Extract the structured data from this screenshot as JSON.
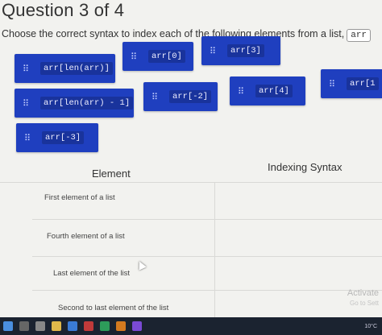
{
  "question": {
    "title": "Question 3 of 4",
    "prompt": "Choose the correct syntax to index each of the following elements from a list,",
    "prompt_code": "arr"
  },
  "chips": [
    {
      "code": "arr[len(arr)]"
    },
    {
      "code": "arr[0]"
    },
    {
      "code": "arr[3]"
    },
    {
      "code": "arr[len(arr) - 1]"
    },
    {
      "code": "arr[-2]"
    },
    {
      "code": "arr[4]"
    },
    {
      "code": "arr[1"
    },
    {
      "code": "arr[-3]"
    }
  ],
  "grip_glyph": "⠿",
  "table": {
    "col_element": "Element",
    "col_syntax": "Indexing Syntax",
    "rows": [
      {
        "label": "First element of a list"
      },
      {
        "label": "Fourth element of a list"
      },
      {
        "label": "Last element of the list"
      },
      {
        "label": "Second to last element of the list"
      }
    ]
  },
  "watermark": {
    "line1": "Activate",
    "line2": "Go to Sett"
  },
  "taskbar": {
    "temp": "10°C"
  },
  "colors": {
    "chip_bg": "#1f3fbf",
    "page_bg": "#f2f2ef"
  }
}
